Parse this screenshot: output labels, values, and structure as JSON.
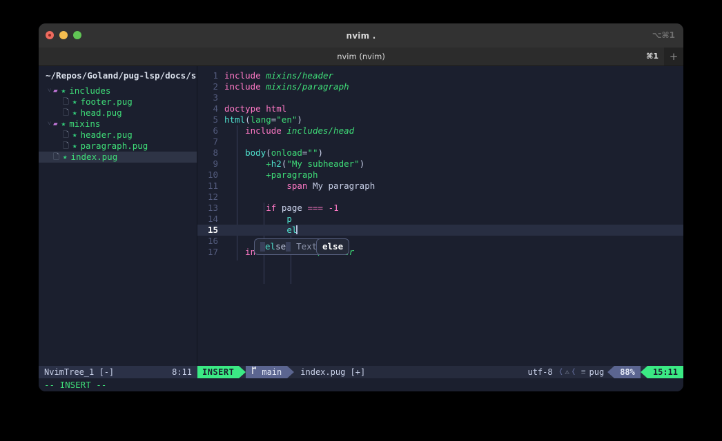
{
  "window": {
    "title": "nvim .",
    "title_shortcut": "⌥⌘1",
    "tab_label": "nvim (nvim)",
    "tab_shortcut": "⌘1",
    "new_tab_label": "+"
  },
  "tree": {
    "root": "~/Repos/Goland/pug-lsp/docs/su",
    "items": [
      {
        "name": "includes",
        "type": "folder",
        "depth": 0,
        "arrow": "˅",
        "mark": "★",
        "selected": false
      },
      {
        "name": "footer.pug",
        "type": "file",
        "depth": 1,
        "arrow": "",
        "mark": "★",
        "selected": false
      },
      {
        "name": "head.pug",
        "type": "file",
        "depth": 1,
        "arrow": "",
        "mark": "★",
        "selected": false
      },
      {
        "name": "mixins",
        "type": "folder",
        "depth": 0,
        "arrow": "˅",
        "mark": "★",
        "selected": false
      },
      {
        "name": "header.pug",
        "type": "file",
        "depth": 1,
        "arrow": "",
        "mark": "★",
        "selected": false
      },
      {
        "name": "paragraph.pug",
        "type": "file",
        "depth": 1,
        "arrow": "",
        "mark": "★",
        "selected": false
      },
      {
        "name": "index.pug",
        "type": "file",
        "depth": 0,
        "arrow": "",
        "mark": "★",
        "selected": true
      }
    ],
    "status_left": "NvimTree_1 [-]",
    "status_right": "8:11"
  },
  "editor": {
    "lines": [
      {
        "n": "1",
        "text": "include mixins/header"
      },
      {
        "n": "2",
        "text": "include mixins/paragraph"
      },
      {
        "n": "3",
        "text": ""
      },
      {
        "n": "4",
        "text": "doctype html"
      },
      {
        "n": "5",
        "text": "html(lang=\"en\")"
      },
      {
        "n": "6",
        "text": "    include includes/head"
      },
      {
        "n": "7",
        "text": ""
      },
      {
        "n": "8",
        "text": "    body(onload=\"\")"
      },
      {
        "n": "9",
        "text": "        +h2(\"My subheader\")"
      },
      {
        "n": "10",
        "text": "        +paragraph"
      },
      {
        "n": "11",
        "text": "            span My paragraph"
      },
      {
        "n": "12",
        "text": ""
      },
      {
        "n": "13",
        "text": "        if page === -1"
      },
      {
        "n": "14",
        "text": "            p"
      },
      {
        "n": "15",
        "text": "            el",
        "current": true
      },
      {
        "n": "16",
        "text": ""
      },
      {
        "n": "17",
        "text": "    include mixins/footer"
      }
    ],
    "completion": {
      "items": [
        {
          "match": "el",
          "rest": "se",
          "kind": "Text"
        }
      ],
      "selected_label": "else"
    }
  },
  "statusline": {
    "mode": "INSERT",
    "branch_icon": "",
    "branch": "main",
    "file": "index.pug [+]",
    "encoding": "utf-8",
    "diagnostic_icon": "⚠",
    "filetype_icon": "≡",
    "filetype": "pug",
    "percent": "88%",
    "position": "15:11"
  },
  "cmdline": "-- INSERT --",
  "colors": {
    "accent_green": "#3bea84",
    "keyword_pink": "#ff79c6",
    "string_green": "#3fdd78",
    "tag_cyan": "#50e3d0",
    "bg": "#1b1f2e",
    "statusbar_blue": "#5b6590"
  }
}
